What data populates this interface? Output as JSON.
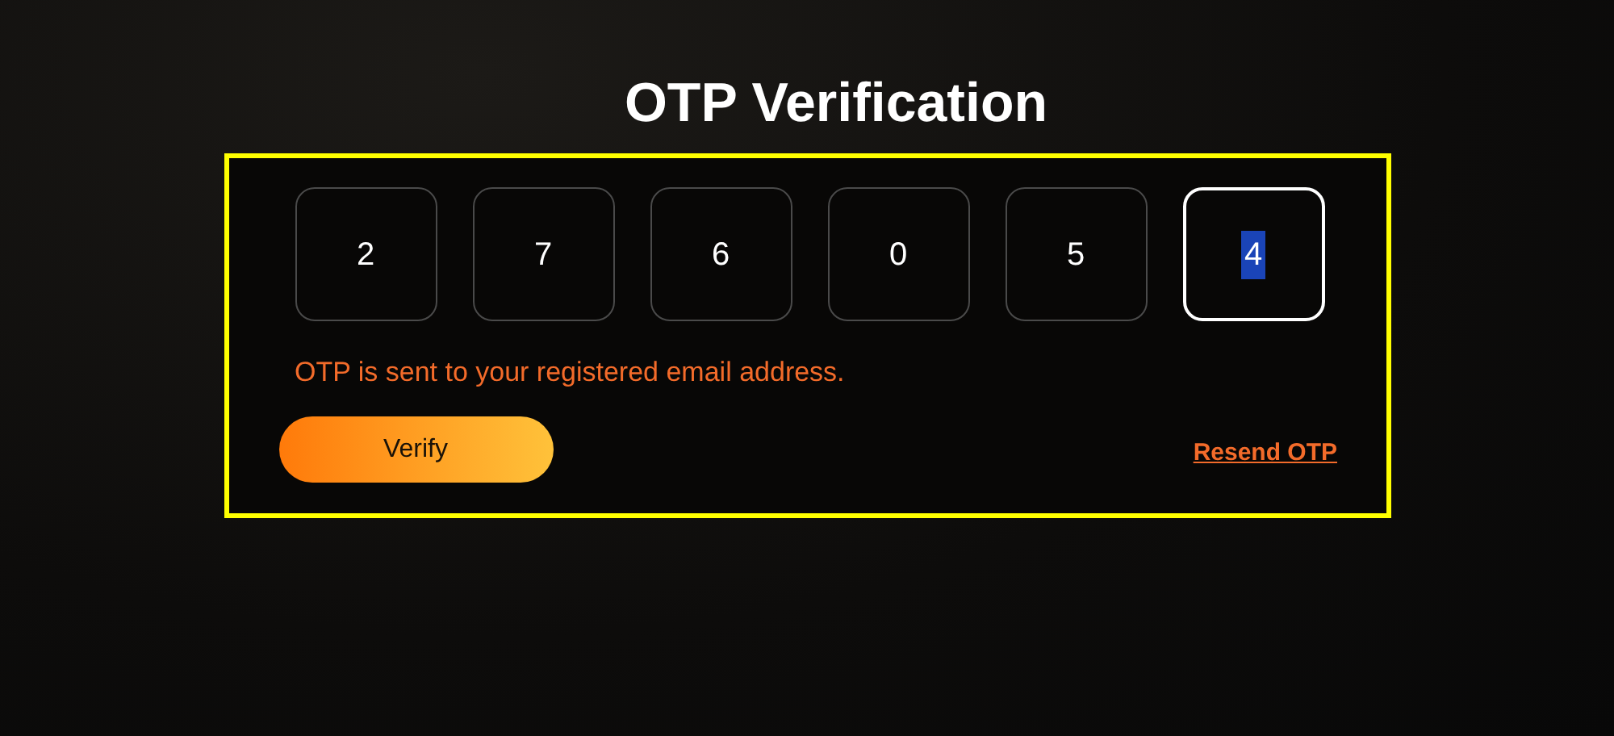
{
  "title": "OTP Verification",
  "otp_digits": [
    {
      "value": "2",
      "selected": false
    },
    {
      "value": "7",
      "selected": false
    },
    {
      "value": "6",
      "selected": false
    },
    {
      "value": "0",
      "selected": false
    },
    {
      "value": "5",
      "selected": false
    },
    {
      "value": "4",
      "selected": true
    }
  ],
  "message": "OTP is sent to your registered email address.",
  "verify_button": "Verify",
  "resend_link": "Resend OTP"
}
